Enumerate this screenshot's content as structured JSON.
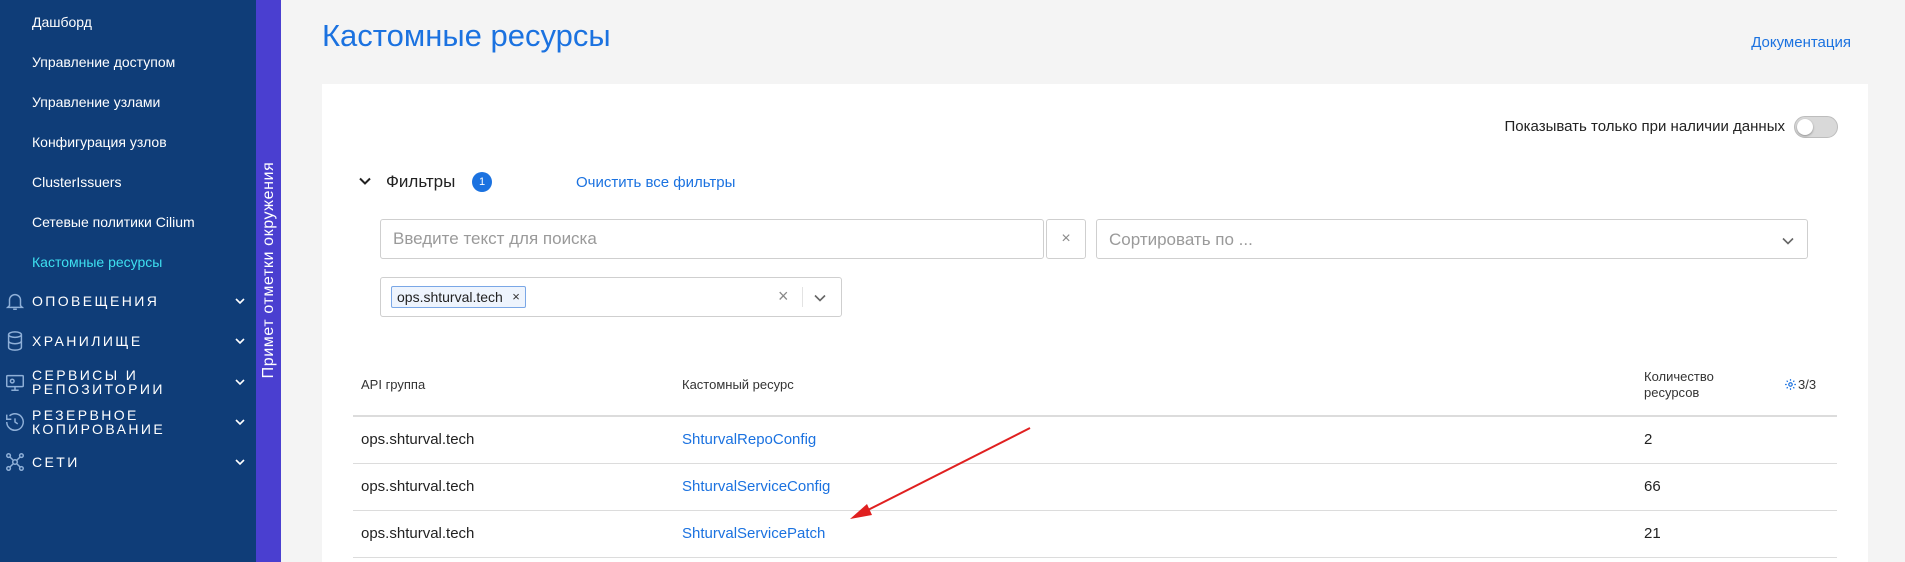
{
  "sidebar": {
    "sub_items": [
      {
        "label": "Дашборд",
        "active": false
      },
      {
        "label": "Управление доступом",
        "active": false
      },
      {
        "label": "Управление узлами",
        "active": false
      },
      {
        "label": "Конфигурация узлов",
        "active": false
      },
      {
        "label": "ClusterIssuers",
        "active": false
      },
      {
        "label": "Сетевые политики Cilium",
        "active": false
      },
      {
        "label": "Кастомные ресурсы",
        "active": true
      }
    ],
    "groups": [
      {
        "label": "Оповещения",
        "icon": "bell-icon"
      },
      {
        "label": "Хранилище",
        "icon": "database-icon"
      },
      {
        "label": "Сервисы и репозитории",
        "icon": "services-icon"
      },
      {
        "label": "Резервное копирование",
        "icon": "backup-icon"
      },
      {
        "label": "Сети",
        "icon": "network-icon"
      }
    ],
    "colors": {
      "background": "#0f3d78",
      "active": "#3ee0f0"
    }
  },
  "environment": {
    "label": "Примет отметки окружения",
    "color": "#4a3fd0"
  },
  "header": {
    "title": "Кастомные ресурсы",
    "doc_link": "Документация"
  },
  "toolbar": {
    "toggle_label": "Показывать только при наличии данных",
    "toggle_on": false
  },
  "filters": {
    "label": "Фильтры",
    "count": "1",
    "clear_label": "Очистить все фильтры",
    "search_placeholder": "Введите текст для поиска",
    "search_clear": "×",
    "sort_placeholder": "Сортировать по ...",
    "tag": "ops.shturval.tech",
    "tag_remove": "×",
    "tag_clear": "×"
  },
  "table": {
    "columns": {
      "api_group": "API группа",
      "resource": "Кастомный ресурс",
      "count_line1": "Количество",
      "count_line2": "ресурсов",
      "settings": "3/3"
    },
    "rows": [
      {
        "api_group": "ops.shturval.tech",
        "resource": "ShturvalRepoConfig",
        "count": "2"
      },
      {
        "api_group": "ops.shturval.tech",
        "resource": "ShturvalServiceConfig",
        "count": "66"
      },
      {
        "api_group": "ops.shturval.tech",
        "resource": "ShturvalServicePatch",
        "count": "21"
      }
    ]
  },
  "colors": {
    "accent": "#1b72e0",
    "annotation_arrow": "#e02020"
  }
}
